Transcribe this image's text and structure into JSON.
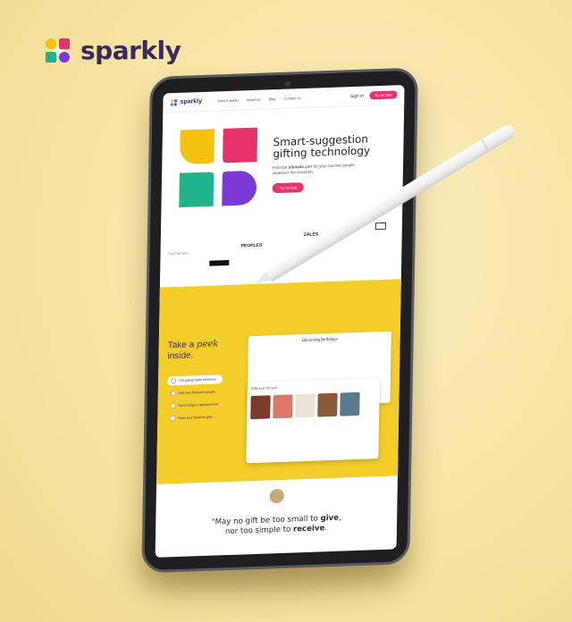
{
  "brand": {
    "name": "sparkly"
  },
  "nav": {
    "logo": "sparkly",
    "links": [
      "How it works",
      "About us",
      "Blog",
      "Contact us"
    ],
    "signin": "Sign in",
    "cta": "Try for free"
  },
  "hero": {
    "title_line1": "Smart-suggestion",
    "title_line2": "gifting technology",
    "sub_pre": "Find the ",
    "sub_emph": "ultimate",
    "sub_post": " gifts for your favorite people,",
    "sub_line2": "whatever the occasion.",
    "cta": "Try for free"
  },
  "partners": {
    "label": "Our Partners",
    "logos": [
      "ZALES",
      "belk",
      "PEOPLES"
    ]
  },
  "peek": {
    "line1_pre": "Take a ",
    "line1_emph": "peek",
    "line2": "inside.",
    "features": [
      "Gift-giving made effortless",
      "Add your favourite people",
      "Never forget a special event",
      "Save your favourite gifts"
    ]
  },
  "mock": {
    "upcoming": "Upcoming Birthdays",
    "gifts": "Gifts just for you"
  },
  "quote": {
    "line1_pre": "\"May no gift be too small to ",
    "line1_emph": "give",
    "line1_post": ",",
    "line2_pre": "nor too simple to ",
    "line2_emph": "receive",
    "line2_post": "."
  },
  "colors": {
    "accent": "#e7336b",
    "yellow": "#f3cd2a",
    "purple": "#3a2a5a"
  }
}
